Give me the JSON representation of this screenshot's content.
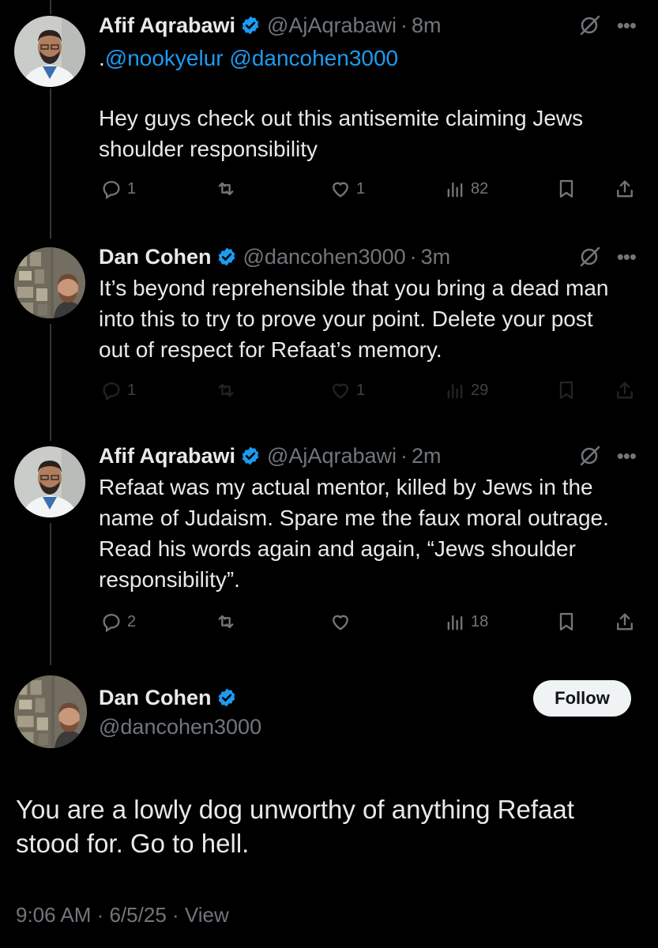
{
  "colors": {
    "background": "#000000",
    "text": "#e7e9ea",
    "muted": "#71767b",
    "accent": "#1d9bf0",
    "verified": "#1d9bf0"
  },
  "icons": [
    "verified-badge-icon",
    "grok-icon",
    "more-icon",
    "reply-icon",
    "retweet-icon",
    "like-icon",
    "views-icon",
    "bookmark-icon",
    "share-icon"
  ],
  "replies": [
    {
      "name": "Afif Aqrabawi",
      "handle": "@AjAqrabawi",
      "time": "8m",
      "mention_prefix": ".",
      "mentions": "@nookyelur @dancohen3000",
      "text": "Hey guys check out this antisemite claiming Jews shoulder responsibility",
      "replies": "1",
      "retweets": "",
      "likes": "1",
      "views": "82"
    },
    {
      "name": "Dan Cohen",
      "handle": "@dancohen3000",
      "time": "3m",
      "text": "It’s beyond reprehensible that you bring a dead man into this to try to prove your point. Delete your post out of respect for Refaat’s memory.",
      "replies": "1",
      "retweets": "",
      "likes": "1",
      "views": "29"
    },
    {
      "name": "Afif Aqrabawi",
      "handle": "@AjAqrabawi",
      "time": "2m",
      "text": "Refaat was my actual mentor, killed by Jews in the name of Judaism. Spare me the faux moral outrage. Read his words again and again, “Jews shoulder responsibility”.",
      "replies": "2",
      "retweets": "",
      "likes": "",
      "views": "18"
    }
  ],
  "main_tweet": {
    "name": "Dan Cohen",
    "handle": "@dancohen3000",
    "follow_label": "Follow",
    "text": "You are a lowly dog unworthy of anything Refaat stood for. Go to hell.",
    "timestamp": "9:06 AM · 6/5/25 · View"
  },
  "separator": "·"
}
